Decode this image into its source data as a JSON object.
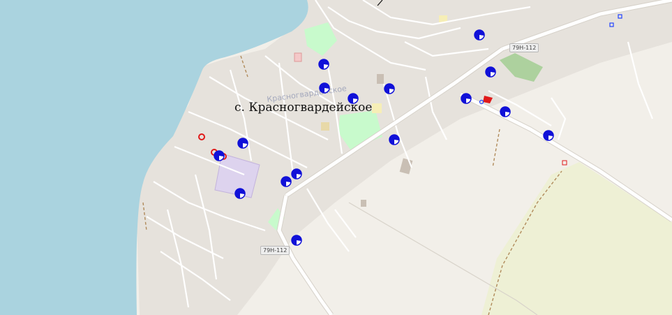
{
  "map": {
    "place_label": "с. Красногвардейское",
    "faint_settlement_label": "Красногвардейское",
    "road_shields": [
      "79Н-112",
      "79Н-112"
    ],
    "marker_icon": "half-filled-blue-circle-icon",
    "marker_count": 17,
    "colors": {
      "water": "#aad3df",
      "land": "#f2efe9",
      "residential": "#e6e2dc",
      "farmland": "#eef0d5",
      "park": "#c8facc",
      "grass": "#add19e",
      "school": "#ddd3ee",
      "marker": "#1010d8",
      "red_mark": "#e01a1a"
    }
  }
}
